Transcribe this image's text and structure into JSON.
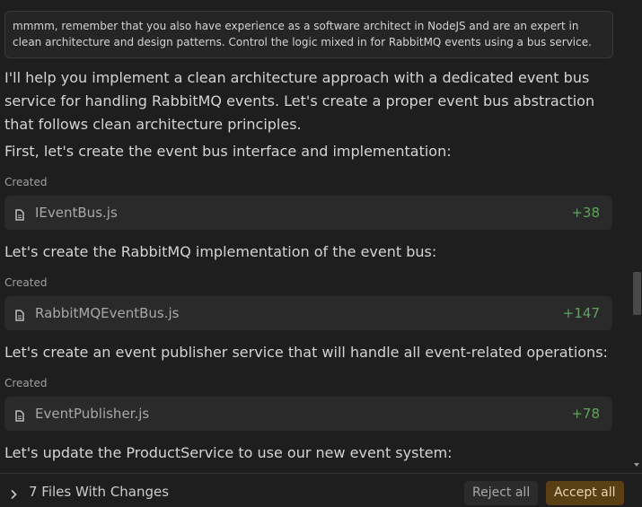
{
  "chat": {
    "user_message": "mmmm, remember that you also have experience as a software architect in NodeJS and are an expert in clean architecture and design patterns. Control the logic mixed in for RabbitMQ events using a bus service.",
    "intro": "I'll help you implement a clean architecture approach with a dedicated event bus service for handling RabbitMQ events. Let's create a proper event bus abstraction that follows clean architecture principles.",
    "steps": [
      {
        "text": "First, let's create the event bus interface and implementation:",
        "created_label": "Created",
        "file": "IEventBus.js",
        "additions": "+38"
      },
      {
        "text": "Let's create the RabbitMQ implementation of the event bus:",
        "created_label": "Created",
        "file": "RabbitMQEventBus.js",
        "additions": "+147"
      },
      {
        "text": "Let's create an event publisher service that will handle all event-related operations:",
        "created_label": "Created",
        "file": "EventPublisher.js",
        "additions": "+78"
      }
    ],
    "next_step": "Let's update the ProductService to use our new event system:"
  },
  "footer": {
    "changes_label": "7 Files With Changes",
    "reject_label": "Reject all",
    "accept_label": "Accept all"
  },
  "icons": {
    "file": "file-icon",
    "chevron": "chevron-right-icon"
  },
  "colors": {
    "additions": "#5fa35f",
    "accept_bg": "#5a3f14"
  }
}
